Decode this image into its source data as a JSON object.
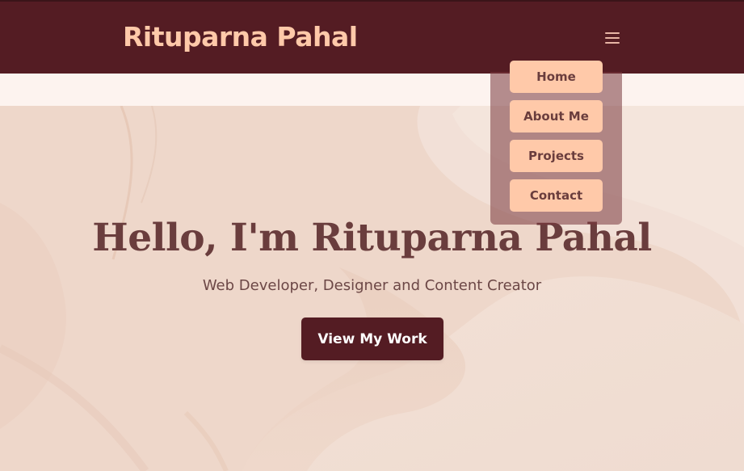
{
  "nav": {
    "brand": "Rituparna Pahal",
    "menu_icon": "hamburger-icon",
    "menu_items": [
      {
        "label": "Home"
      },
      {
        "label": "About Me"
      },
      {
        "label": "Projects"
      },
      {
        "label": "Contact"
      }
    ]
  },
  "hero": {
    "title": "Hello, I'm Rituparna Pahal",
    "subtitle": "Web Developer, Designer and Content Creator",
    "cta_label": "View My Work"
  },
  "colors": {
    "primary": "#541c23",
    "accent": "#ffc9a9",
    "hero_text": "#6a3d3d",
    "background": "#eed7ca"
  }
}
